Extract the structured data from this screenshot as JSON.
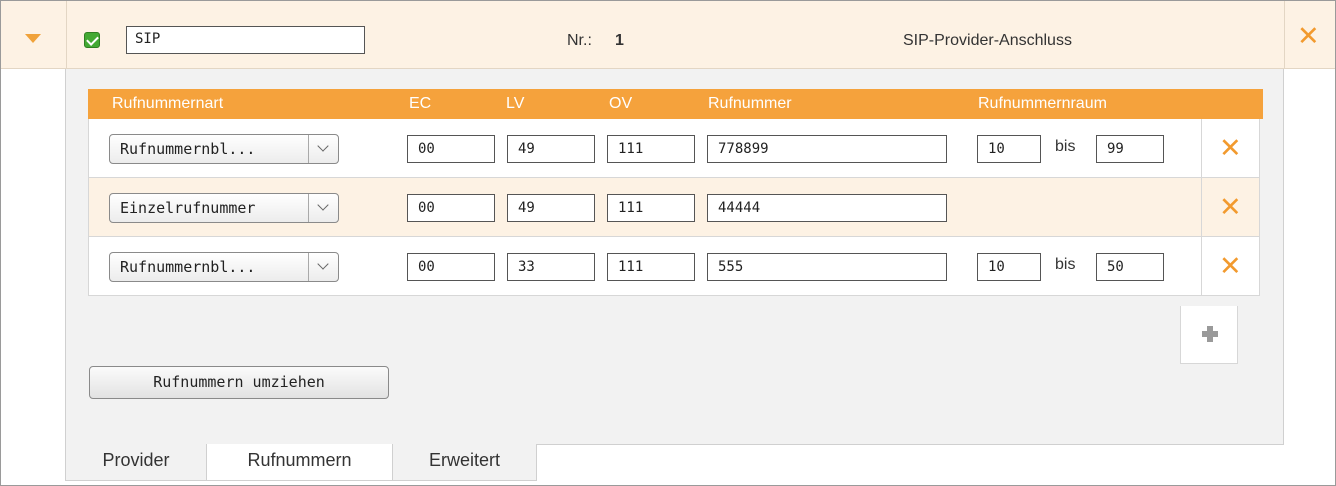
{
  "header": {
    "collapse_icon": "chevron-down-icon",
    "enabled": true,
    "name_value": "SIP",
    "nr_label": "Nr.:",
    "nr_value": "1",
    "provider_type": "SIP-Provider-Anschluss",
    "close_icon": "close-icon"
  },
  "table": {
    "columns": [
      "Rufnummernart",
      "EC",
      "LV",
      "OV",
      "Rufnummer",
      "Rufnummernraum"
    ],
    "rows": [
      {
        "type": "Rufnummernbl...",
        "ec": "00",
        "lv": "49",
        "ov": "111",
        "number": "778899",
        "range_from": "10",
        "range_to": "99",
        "bis": "bis"
      },
      {
        "type": "Einzelrufnummer",
        "ec": "00",
        "lv": "49",
        "ov": "111",
        "number": "44444"
      },
      {
        "type": "Rufnummernbl...",
        "ec": "00",
        "lv": "33",
        "ov": "111",
        "number": "555",
        "range_from": "10",
        "range_to": "50",
        "bis": "bis"
      }
    ]
  },
  "actions": {
    "add_icon": "plus-icon",
    "delete_icon": "close-icon",
    "move_numbers_label": "Rufnummern umziehen"
  },
  "tabs": [
    {
      "label": "Provider",
      "active": false
    },
    {
      "label": "Rufnummern",
      "active": true
    },
    {
      "label": "Erweitert",
      "active": false
    }
  ],
  "colors": {
    "accent_orange": "#f5a23c",
    "row_highlight": "#fdf2e4",
    "checkbox_green": "#43a933"
  }
}
